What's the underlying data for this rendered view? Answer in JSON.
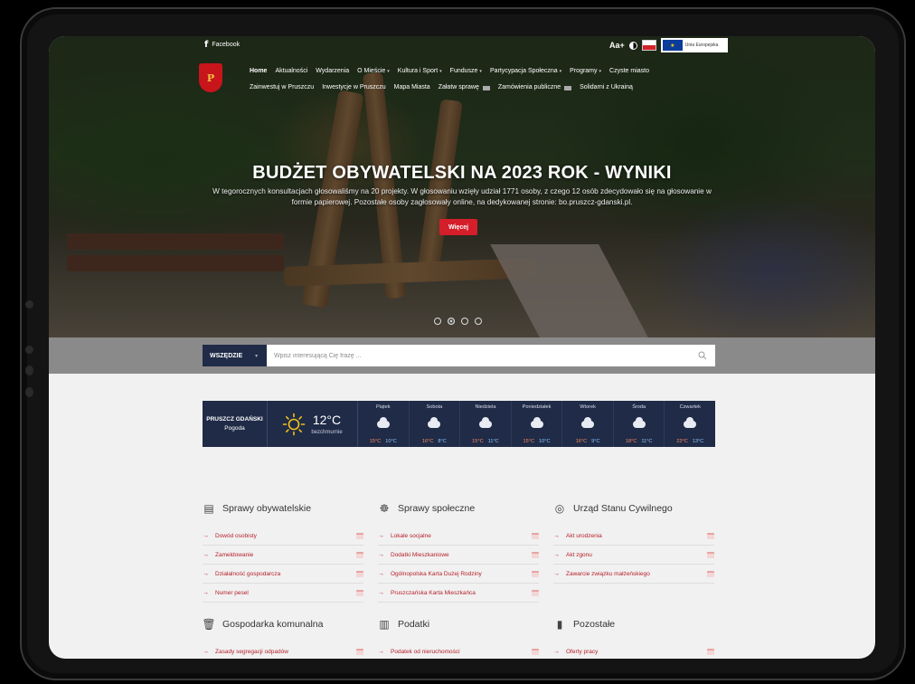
{
  "topbar": {
    "facebook_label": "Facebook",
    "font_size_label": "Aa+",
    "eu_label": "Unia Europejska"
  },
  "crest_text": "P",
  "nav": {
    "row1": [
      {
        "label": "Home",
        "active": true,
        "caret": false
      },
      {
        "label": "Aktualności",
        "caret": false
      },
      {
        "label": "Wydarzenia",
        "caret": false
      },
      {
        "label": "O Mieście",
        "caret": true
      },
      {
        "label": "Kultura i Sport",
        "caret": true
      },
      {
        "label": "Fundusze",
        "caret": true
      },
      {
        "label": "Partycypacja Społeczna",
        "caret": true
      },
      {
        "label": "Programy",
        "caret": true
      },
      {
        "label": "Czyste miasto",
        "caret": false
      }
    ],
    "row2": [
      {
        "label": "Zainwestuj w Pruszczu"
      },
      {
        "label": "Inwestycje w Pruszczu"
      },
      {
        "label": "Mapa Miasta"
      },
      {
        "label": "Załatw sprawę"
      },
      {
        "label": "Zamówienia publiczne"
      },
      {
        "label": "Solidarni z Ukrainą"
      }
    ]
  },
  "hero": {
    "title": "BUDŻET OBYWATELSKI NA 2023 ROK - WYNIKI",
    "text": "W tegorocznych konsultacjach głosowaliśmy na 20 projekty. W głosowaniu wzięły udział 1771 osoby, z czego 12 osób zdecydowało się na głosowanie w formie papierowej. Pozostałe osoby zagłosowały online, na dedykowanej stronie: bo.pruszcz-gdanski.pl.",
    "button": "Więcej",
    "slides": 4,
    "active_slide": 2
  },
  "search": {
    "scope_label": "WSZĘDZIE",
    "placeholder": "Wpisz interesującą Cię frazę ..."
  },
  "weather": {
    "city": "PRUSZCZ GDAŃSKI",
    "label": "Pogoda",
    "temp": "12°C",
    "desc": "bezchmurnie",
    "days": [
      {
        "name": "Piątek",
        "hi": "15°C",
        "lo": "10°C"
      },
      {
        "name": "Sobota",
        "hi": "16°C",
        "lo": "8°C"
      },
      {
        "name": "Niedziela",
        "hi": "15°C",
        "lo": "11°C"
      },
      {
        "name": "Poniedziałek",
        "hi": "15°C",
        "lo": "10°C"
      },
      {
        "name": "Wtorek",
        "hi": "16°C",
        "lo": "9°C"
      },
      {
        "name": "Środa",
        "hi": "18°C",
        "lo": "11°C"
      },
      {
        "name": "Czwartek",
        "hi": "23°C",
        "lo": "13°C"
      }
    ]
  },
  "categories": [
    {
      "title": "Sprawy obywatelskie",
      "icon": "id-card-icon",
      "items": [
        "Dowód osobisty",
        "Zameldowanie",
        "Działalność gospodarcza",
        "Numer pesel"
      ]
    },
    {
      "title": "Sprawy społeczne",
      "icon": "people-icon",
      "items": [
        "Lokale socjalne",
        "Dodatki Mieszkaniowe",
        "Ogólnopolska Karta Dużej Rodziny",
        "Pruszczańska Karta Mieszkańca"
      ]
    },
    {
      "title": "Urząd Stanu Cywilnego",
      "icon": "rings-icon",
      "items": [
        "Akt urodzenia",
        "Akt zgonu",
        "Zawarcie związku małżeńskiego"
      ]
    },
    {
      "title": "Gospodarka komunalna",
      "icon": "trash-icon",
      "items": [
        "Zasady segregacji odpadów"
      ]
    },
    {
      "title": "Podatki",
      "icon": "tax-document-icon",
      "items": [
        "Podatek od nieruchomości"
      ]
    },
    {
      "title": "Pozostałe",
      "icon": "document-icon",
      "items": [
        "Oferty pracy"
      ]
    }
  ],
  "colors": {
    "accent": "#d41e2a",
    "navy": "#1f2b47",
    "link": "#b5212b"
  }
}
